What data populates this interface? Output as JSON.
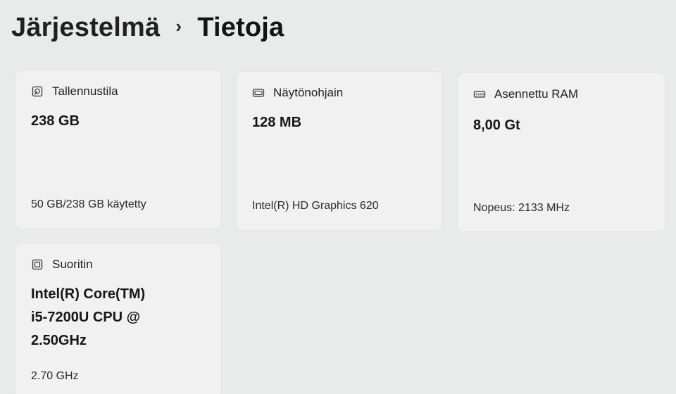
{
  "breadcrumb": {
    "parent": "Järjestelmä",
    "separator": "›",
    "current": "Tietoja"
  },
  "cards": {
    "storage": {
      "icon": "storage-drive-icon",
      "label": "Tallennustila",
      "value": "238 GB",
      "detail": "50 GB/238 GB käytetty"
    },
    "gpu": {
      "icon": "graphics-card-icon",
      "label": "Näytönohjain",
      "value": "128 MB",
      "detail": "Intel(R) HD Graphics 620"
    },
    "ram": {
      "icon": "memory-icon",
      "label": "Asennettu RAM",
      "value": "8,00 Gt",
      "detail": "Nopeus: 2133 MHz"
    },
    "cpu": {
      "icon": "processor-icon",
      "label": "Suoritin",
      "value_lines": [
        "Intel(R) Core(TM)",
        "i5-7200U CPU @",
        "2.50GHz"
      ],
      "detail": "2.70 GHz"
    }
  }
}
